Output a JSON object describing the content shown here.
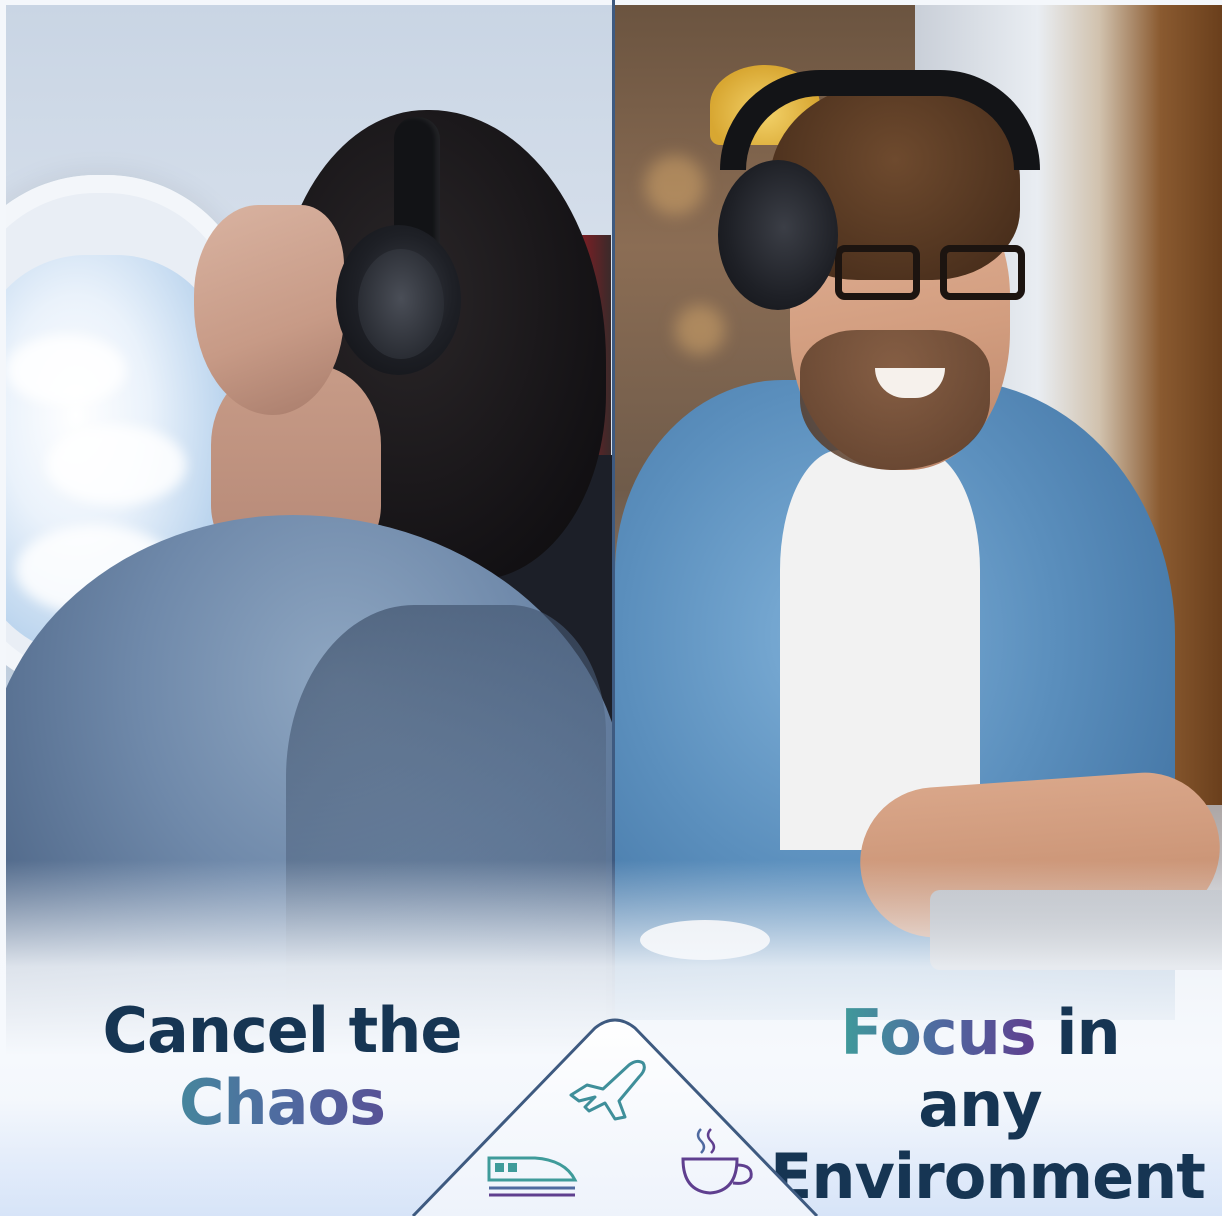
{
  "left_caption": {
    "line1": "Cancel the",
    "line2": "Chaos"
  },
  "right_caption": {
    "line1_accent": "Focus",
    "line1_rest": " in any",
    "line2": "Environment"
  },
  "badge_icons": [
    "airplane-icon",
    "train-icon",
    "coffee-cup-icon"
  ],
  "colors": {
    "text_dark": "#163553",
    "gradient_start": "#3f9b9a",
    "gradient_end": "#5f3f8f",
    "divider": "#3e5a80"
  }
}
